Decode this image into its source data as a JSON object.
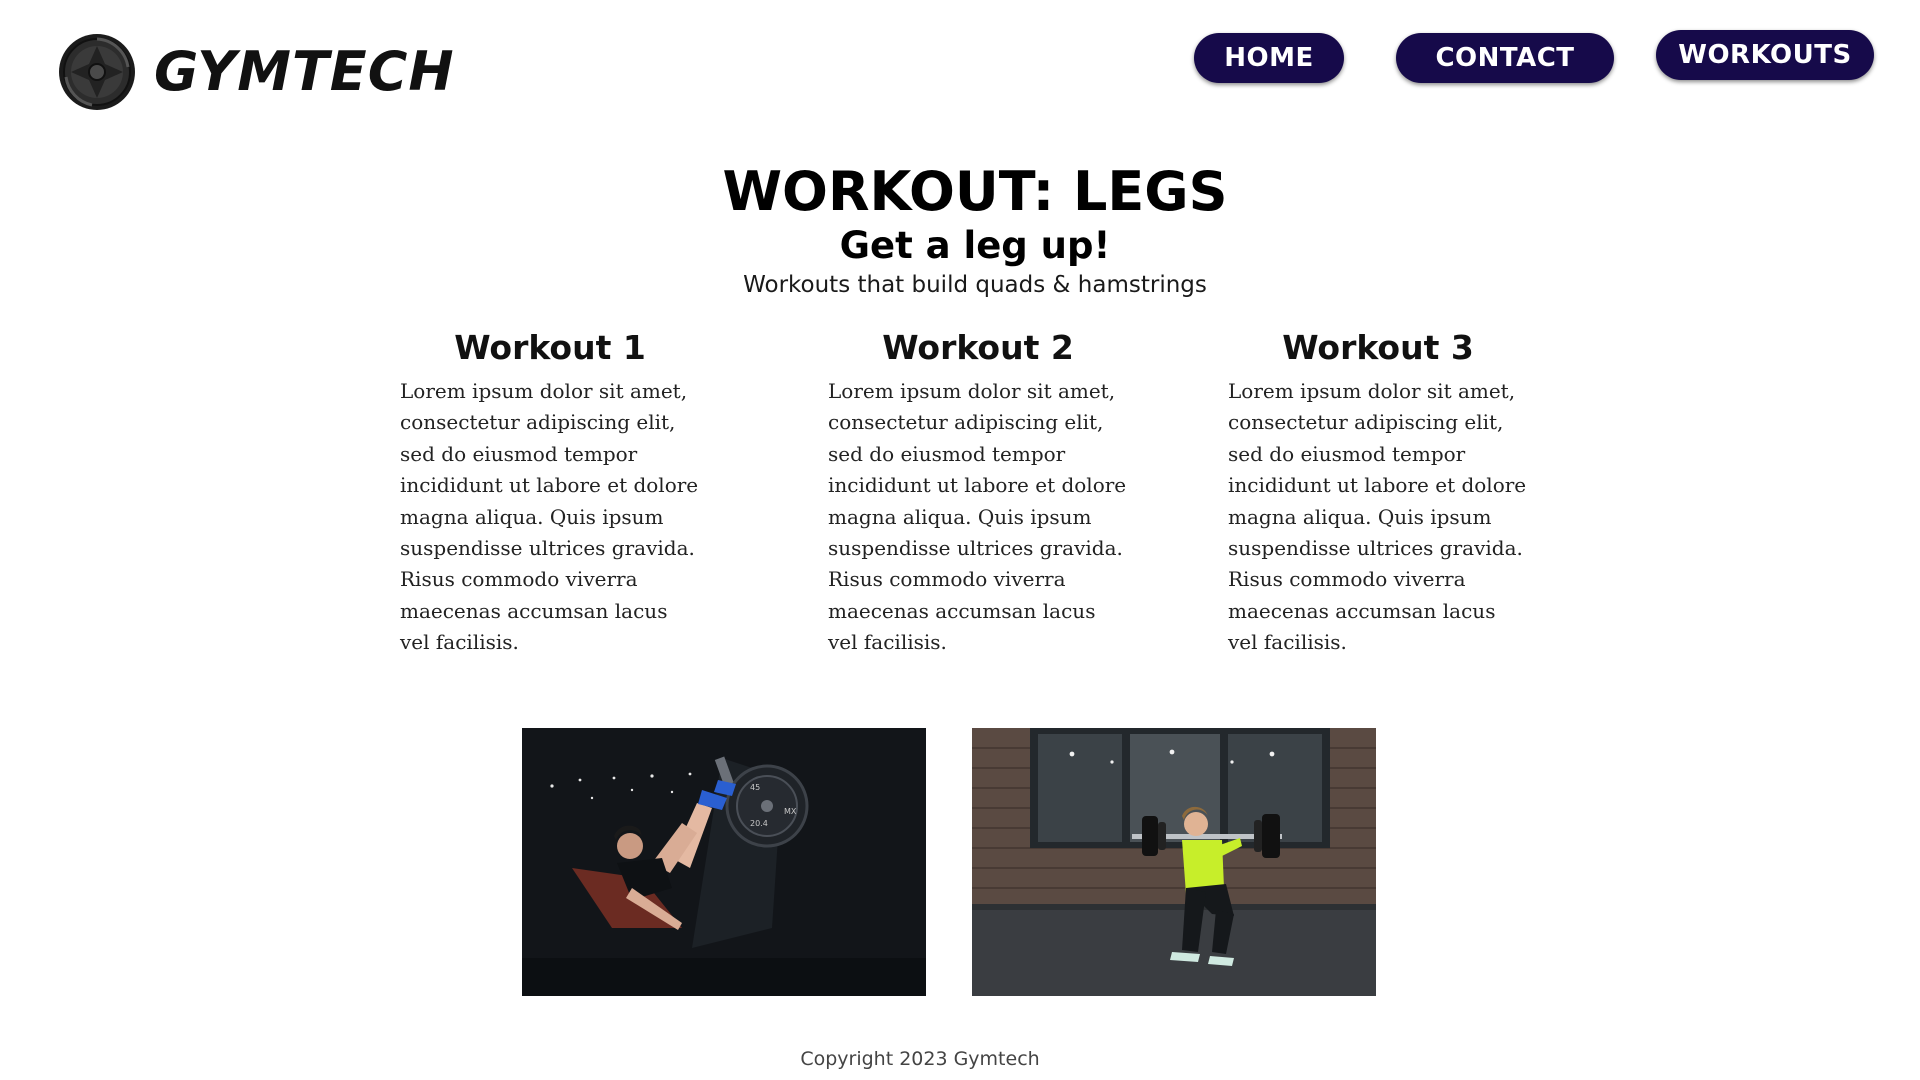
{
  "header": {
    "brand_name": "GYMTECH",
    "logo_icon": "gymtech-logo-icon",
    "nav": [
      {
        "label": "HOME"
      },
      {
        "label": "CONTACT"
      },
      {
        "label": "WORKOUTS"
      }
    ]
  },
  "hero": {
    "title": "WORKOUT: LEGS",
    "subtitle": "Get a leg up!",
    "tagline": "Workouts that build quads & hamstrings"
  },
  "workouts": [
    {
      "title": "Workout 1",
      "text": "Lorem ipsum dolor sit amet, consectetur adipiscing elit, sed do eiusmod tempor incididunt ut labore et dolore magna aliqua. Quis ipsum suspendisse ultrices gravida. Risus commodo viverra maecenas accumsan lacus vel facilisis."
    },
    {
      "title": "Workout 2",
      "text": "Lorem ipsum dolor sit amet, consectetur adipiscing elit, sed do eiusmod tempor incididunt ut labore et dolore magna aliqua. Quis ipsum suspendisse ultrices gravida. Risus commodo viverra maecenas accumsan lacus vel facilisis."
    },
    {
      "title": "Workout 3",
      "text": "Lorem ipsum dolor sit amet, consectetur adipiscing elit, sed do eiusmod tempor incididunt ut labore et dolore magna aliqua. Quis ipsum suspendisse ultrices gravida. Risus commodo viverra maecenas accumsan lacus vel facilisis."
    }
  ],
  "photos": [
    {
      "name": "leg-press-photo",
      "plate_labels": [
        "45",
        "20.4",
        "MX"
      ]
    },
    {
      "name": "barbell-squat-photo"
    }
  ],
  "footer": {
    "copyright": "Copyright 2023 Gymtech"
  },
  "colors": {
    "nav_button_bg": "#160a4a",
    "nav_button_text": "#ffffff",
    "page_bg": "#ffffff",
    "text": "#000000"
  }
}
